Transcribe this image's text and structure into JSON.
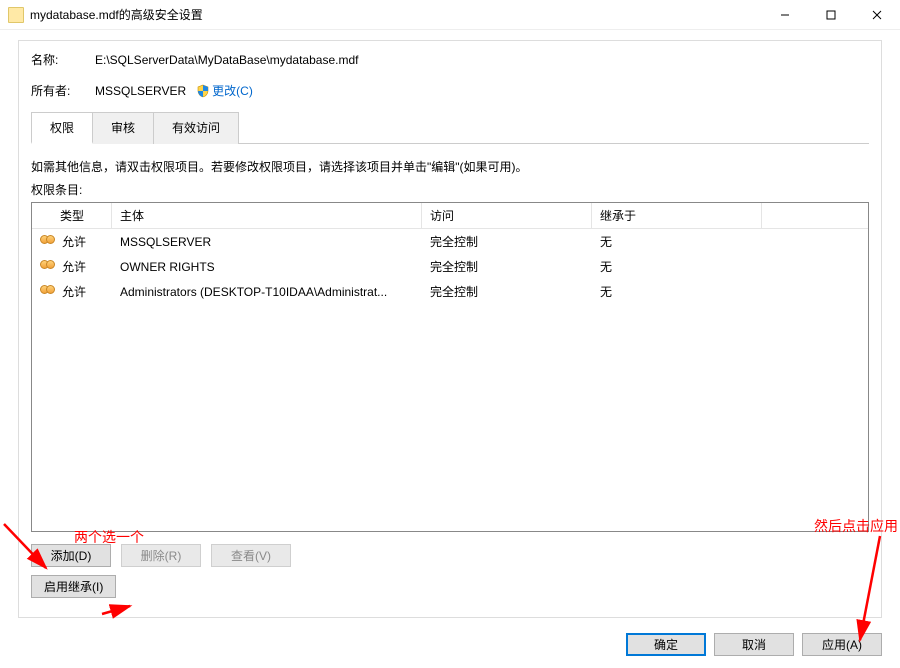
{
  "window": {
    "title": "mydatabase.mdf的高级安全设置"
  },
  "header": {
    "name_label": "名称:",
    "name_value": "E:\\SQLServerData\\MyDataBase\\mydatabase.mdf",
    "owner_label": "所有者:",
    "owner_value": "MSSQLSERVER",
    "change_link": "更改(C)"
  },
  "tabs": {
    "permissions": "权限",
    "audit": "审核",
    "effective": "有效访问"
  },
  "info_text": "如需其他信息，请双击权限项目。若要修改权限项目，请选择该项目并单击\"编辑\"(如果可用)。",
  "entries_label": "权限条目:",
  "columns": {
    "type": "类型",
    "principal": "主体",
    "access": "访问",
    "inherited": "继承于"
  },
  "rows": [
    {
      "type": "允许",
      "principal": "MSSQLSERVER",
      "access": "完全控制",
      "inherited": "无"
    },
    {
      "type": "允许",
      "principal": "OWNER RIGHTS",
      "access": "完全控制",
      "inherited": "无"
    },
    {
      "type": "允许",
      "principal": "Administrators (DESKTOP-T10IDAA\\Administrat...",
      "access": "完全控制",
      "inherited": "无"
    }
  ],
  "buttons": {
    "add": "添加(D)",
    "remove": "删除(R)",
    "view": "查看(V)",
    "enable_inherit": "启用继承(I)",
    "ok": "确定",
    "cancel": "取消",
    "apply": "应用(A)"
  },
  "annotations": {
    "left": "两个选一个",
    "right": "然后点击应用"
  }
}
